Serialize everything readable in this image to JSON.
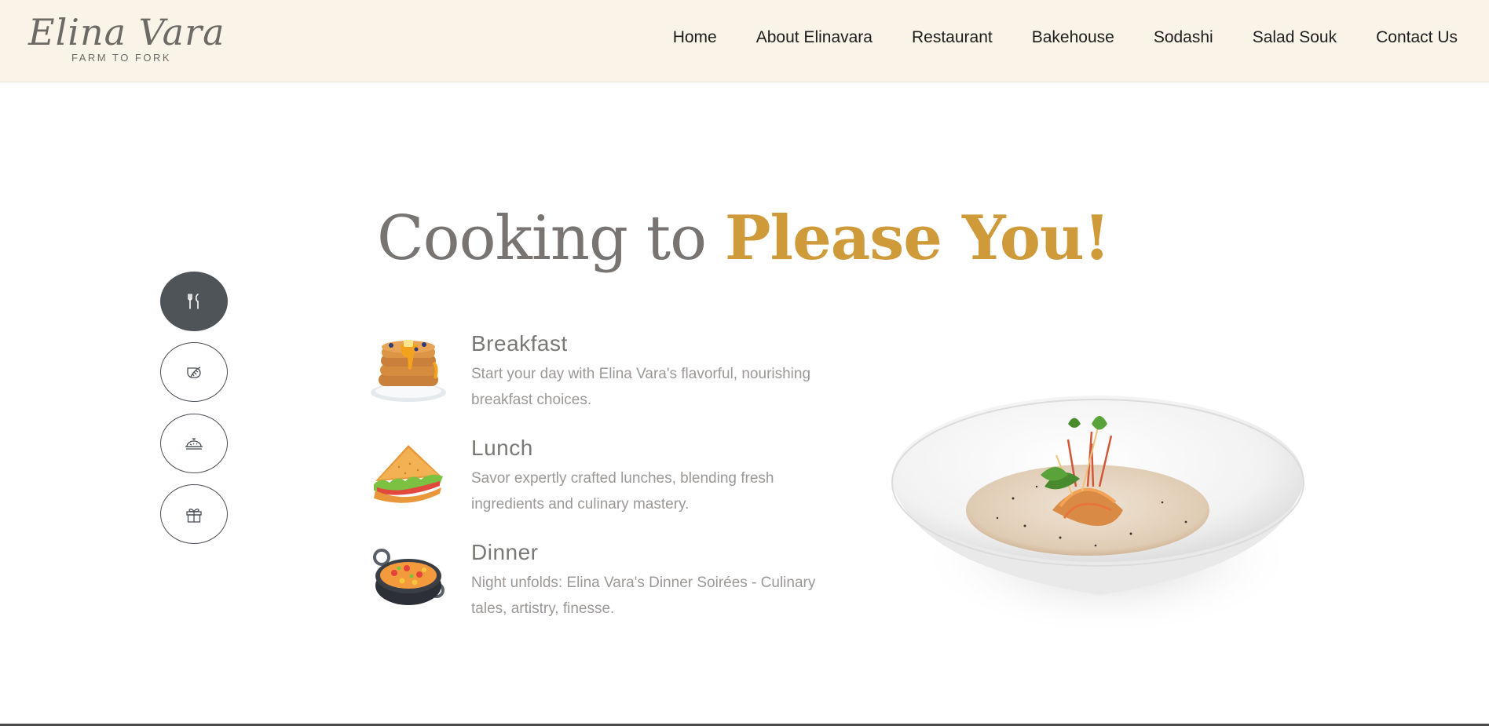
{
  "brand": {
    "logo_script": "Elina Vara",
    "logo_tagline": "FARM TO FORK"
  },
  "nav": {
    "items": [
      {
        "label": "Home"
      },
      {
        "label": "About Elinavara"
      },
      {
        "label": "Restaurant"
      },
      {
        "label": "Bakehouse"
      },
      {
        "label": "Sodashi"
      },
      {
        "label": "Salad Souk"
      },
      {
        "label": "Contact Us"
      }
    ]
  },
  "sidebar": {
    "buttons": [
      {
        "icon": "cutlery-icon",
        "active": true
      },
      {
        "icon": "leaf-icon",
        "active": false
      },
      {
        "icon": "cloche-icon",
        "active": false
      },
      {
        "icon": "gift-icon",
        "active": false
      }
    ]
  },
  "hero": {
    "headline_part1": "Cooking to ",
    "headline_part2": "Please You!"
  },
  "meals": [
    {
      "title": "Breakfast",
      "desc": "Start your day with Elina Vara's flavorful, nourishing breakfast choices.",
      "icon": "pancakes-icon"
    },
    {
      "title": "Lunch",
      "desc": "Savor expertly crafted lunches, blending fresh ingredients and culinary mastery.",
      "icon": "sandwich-icon"
    },
    {
      "title": "Dinner",
      "desc": "Night unfolds: Elina Vara's Dinner Soirées - Culinary tales, artistry, finesse.",
      "icon": "pot-icon"
    }
  ],
  "colors": {
    "header_bg": "#faf3e8",
    "accent": "#cf9a3a",
    "heading_gray": "#777472",
    "active_button": "#4f5459"
  }
}
